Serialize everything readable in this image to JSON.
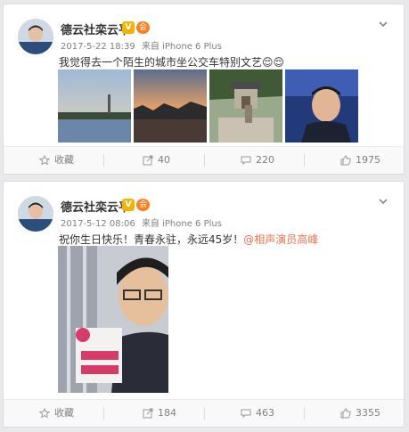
{
  "posts": [
    {
      "username": "德云社栾云平",
      "verified_badge": "V",
      "member_badge": "会",
      "time": "2017-5-22 18:39",
      "source": "来自 iPhone 6 Plus",
      "text": "我觉得去一个陌生的城市坐公交车特别文艺",
      "text_emoji": "😌😌",
      "actions": {
        "favorite": "收藏",
        "repost": "40",
        "comment": "220",
        "like": "1975"
      }
    },
    {
      "username": "德云社栾云平",
      "verified_badge": "V",
      "member_badge": "会",
      "time": "2017-5-12 08:06",
      "source": "来自 iPhone 6 Plus",
      "text": "祝你生日快乐！青春永驻，永远45岁！",
      "mention": "@相声演员高峰",
      "actions": {
        "favorite": "收藏",
        "repost": "184",
        "comment": "463",
        "like": "3355"
      }
    }
  ],
  "icons": {
    "favorite": "star-icon",
    "repost": "repost-icon",
    "comment": "comment-icon",
    "like": "thumbs-up-icon",
    "menu": "chevron-down-icon"
  },
  "colors": {
    "mention": "#eb7350",
    "verified": "#f7b100",
    "member": "#ff7d1a"
  }
}
